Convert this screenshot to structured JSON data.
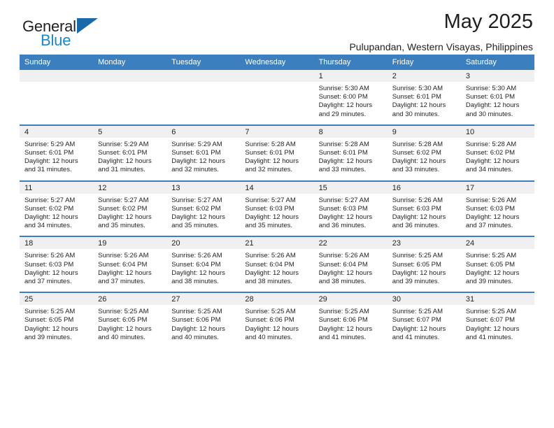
{
  "brand": {
    "name_part1": "General",
    "name_part2": "Blue",
    "logo_icon": "triangle-logo-mark"
  },
  "header": {
    "month_title": "May 2025",
    "location": "Pulupandan, Western Visayas, Philippines"
  },
  "colors": {
    "header_blue": "#3c7fbf",
    "brand_blue": "#1a86d0",
    "logo_blue": "#1769aa",
    "daynum_band": "#f0f0f0",
    "text": "#231f20"
  },
  "weekday_headers": [
    "Sunday",
    "Monday",
    "Tuesday",
    "Wednesday",
    "Thursday",
    "Friday",
    "Saturday"
  ],
  "weeks": [
    [
      {
        "day": "",
        "sunrise": "",
        "sunset": "",
        "daylight_line1": "",
        "daylight_line2": ""
      },
      {
        "day": "",
        "sunrise": "",
        "sunset": "",
        "daylight_line1": "",
        "daylight_line2": ""
      },
      {
        "day": "",
        "sunrise": "",
        "sunset": "",
        "daylight_line1": "",
        "daylight_line2": ""
      },
      {
        "day": "",
        "sunrise": "",
        "sunset": "",
        "daylight_line1": "",
        "daylight_line2": ""
      },
      {
        "day": "1",
        "sunrise": "Sunrise: 5:30 AM",
        "sunset": "Sunset: 6:00 PM",
        "daylight_line1": "Daylight: 12 hours",
        "daylight_line2": "and 29 minutes."
      },
      {
        "day": "2",
        "sunrise": "Sunrise: 5:30 AM",
        "sunset": "Sunset: 6:01 PM",
        "daylight_line1": "Daylight: 12 hours",
        "daylight_line2": "and 30 minutes."
      },
      {
        "day": "3",
        "sunrise": "Sunrise: 5:30 AM",
        "sunset": "Sunset: 6:01 PM",
        "daylight_line1": "Daylight: 12 hours",
        "daylight_line2": "and 30 minutes."
      }
    ],
    [
      {
        "day": "4",
        "sunrise": "Sunrise: 5:29 AM",
        "sunset": "Sunset: 6:01 PM",
        "daylight_line1": "Daylight: 12 hours",
        "daylight_line2": "and 31 minutes."
      },
      {
        "day": "5",
        "sunrise": "Sunrise: 5:29 AM",
        "sunset": "Sunset: 6:01 PM",
        "daylight_line1": "Daylight: 12 hours",
        "daylight_line2": "and 31 minutes."
      },
      {
        "day": "6",
        "sunrise": "Sunrise: 5:29 AM",
        "sunset": "Sunset: 6:01 PM",
        "daylight_line1": "Daylight: 12 hours",
        "daylight_line2": "and 32 minutes."
      },
      {
        "day": "7",
        "sunrise": "Sunrise: 5:28 AM",
        "sunset": "Sunset: 6:01 PM",
        "daylight_line1": "Daylight: 12 hours",
        "daylight_line2": "and 32 minutes."
      },
      {
        "day": "8",
        "sunrise": "Sunrise: 5:28 AM",
        "sunset": "Sunset: 6:01 PM",
        "daylight_line1": "Daylight: 12 hours",
        "daylight_line2": "and 33 minutes."
      },
      {
        "day": "9",
        "sunrise": "Sunrise: 5:28 AM",
        "sunset": "Sunset: 6:02 PM",
        "daylight_line1": "Daylight: 12 hours",
        "daylight_line2": "and 33 minutes."
      },
      {
        "day": "10",
        "sunrise": "Sunrise: 5:28 AM",
        "sunset": "Sunset: 6:02 PM",
        "daylight_line1": "Daylight: 12 hours",
        "daylight_line2": "and 34 minutes."
      }
    ],
    [
      {
        "day": "11",
        "sunrise": "Sunrise: 5:27 AM",
        "sunset": "Sunset: 6:02 PM",
        "daylight_line1": "Daylight: 12 hours",
        "daylight_line2": "and 34 minutes."
      },
      {
        "day": "12",
        "sunrise": "Sunrise: 5:27 AM",
        "sunset": "Sunset: 6:02 PM",
        "daylight_line1": "Daylight: 12 hours",
        "daylight_line2": "and 35 minutes."
      },
      {
        "day": "13",
        "sunrise": "Sunrise: 5:27 AM",
        "sunset": "Sunset: 6:02 PM",
        "daylight_line1": "Daylight: 12 hours",
        "daylight_line2": "and 35 minutes."
      },
      {
        "day": "14",
        "sunrise": "Sunrise: 5:27 AM",
        "sunset": "Sunset: 6:03 PM",
        "daylight_line1": "Daylight: 12 hours",
        "daylight_line2": "and 35 minutes."
      },
      {
        "day": "15",
        "sunrise": "Sunrise: 5:27 AM",
        "sunset": "Sunset: 6:03 PM",
        "daylight_line1": "Daylight: 12 hours",
        "daylight_line2": "and 36 minutes."
      },
      {
        "day": "16",
        "sunrise": "Sunrise: 5:26 AM",
        "sunset": "Sunset: 6:03 PM",
        "daylight_line1": "Daylight: 12 hours",
        "daylight_line2": "and 36 minutes."
      },
      {
        "day": "17",
        "sunrise": "Sunrise: 5:26 AM",
        "sunset": "Sunset: 6:03 PM",
        "daylight_line1": "Daylight: 12 hours",
        "daylight_line2": "and 37 minutes."
      }
    ],
    [
      {
        "day": "18",
        "sunrise": "Sunrise: 5:26 AM",
        "sunset": "Sunset: 6:03 PM",
        "daylight_line1": "Daylight: 12 hours",
        "daylight_line2": "and 37 minutes."
      },
      {
        "day": "19",
        "sunrise": "Sunrise: 5:26 AM",
        "sunset": "Sunset: 6:04 PM",
        "daylight_line1": "Daylight: 12 hours",
        "daylight_line2": "and 37 minutes."
      },
      {
        "day": "20",
        "sunrise": "Sunrise: 5:26 AM",
        "sunset": "Sunset: 6:04 PM",
        "daylight_line1": "Daylight: 12 hours",
        "daylight_line2": "and 38 minutes."
      },
      {
        "day": "21",
        "sunrise": "Sunrise: 5:26 AM",
        "sunset": "Sunset: 6:04 PM",
        "daylight_line1": "Daylight: 12 hours",
        "daylight_line2": "and 38 minutes."
      },
      {
        "day": "22",
        "sunrise": "Sunrise: 5:26 AM",
        "sunset": "Sunset: 6:04 PM",
        "daylight_line1": "Daylight: 12 hours",
        "daylight_line2": "and 38 minutes."
      },
      {
        "day": "23",
        "sunrise": "Sunrise: 5:25 AM",
        "sunset": "Sunset: 6:05 PM",
        "daylight_line1": "Daylight: 12 hours",
        "daylight_line2": "and 39 minutes."
      },
      {
        "day": "24",
        "sunrise": "Sunrise: 5:25 AM",
        "sunset": "Sunset: 6:05 PM",
        "daylight_line1": "Daylight: 12 hours",
        "daylight_line2": "and 39 minutes."
      }
    ],
    [
      {
        "day": "25",
        "sunrise": "Sunrise: 5:25 AM",
        "sunset": "Sunset: 6:05 PM",
        "daylight_line1": "Daylight: 12 hours",
        "daylight_line2": "and 39 minutes."
      },
      {
        "day": "26",
        "sunrise": "Sunrise: 5:25 AM",
        "sunset": "Sunset: 6:05 PM",
        "daylight_line1": "Daylight: 12 hours",
        "daylight_line2": "and 40 minutes."
      },
      {
        "day": "27",
        "sunrise": "Sunrise: 5:25 AM",
        "sunset": "Sunset: 6:06 PM",
        "daylight_line1": "Daylight: 12 hours",
        "daylight_line2": "and 40 minutes."
      },
      {
        "day": "28",
        "sunrise": "Sunrise: 5:25 AM",
        "sunset": "Sunset: 6:06 PM",
        "daylight_line1": "Daylight: 12 hours",
        "daylight_line2": "and 40 minutes."
      },
      {
        "day": "29",
        "sunrise": "Sunrise: 5:25 AM",
        "sunset": "Sunset: 6:06 PM",
        "daylight_line1": "Daylight: 12 hours",
        "daylight_line2": "and 41 minutes."
      },
      {
        "day": "30",
        "sunrise": "Sunrise: 5:25 AM",
        "sunset": "Sunset: 6:07 PM",
        "daylight_line1": "Daylight: 12 hours",
        "daylight_line2": "and 41 minutes."
      },
      {
        "day": "31",
        "sunrise": "Sunrise: 5:25 AM",
        "sunset": "Sunset: 6:07 PM",
        "daylight_line1": "Daylight: 12 hours",
        "daylight_line2": "and 41 minutes."
      }
    ]
  ]
}
